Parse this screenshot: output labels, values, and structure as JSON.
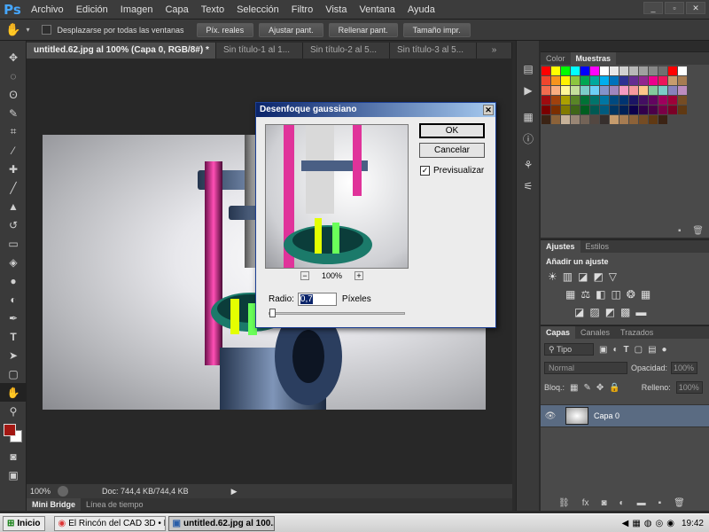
{
  "app": {
    "logo": "Ps"
  },
  "menu": [
    "Archivo",
    "Edición",
    "Imagen",
    "Capa",
    "Texto",
    "Selección",
    "Filtro",
    "Vista",
    "Ventana",
    "Ayuda"
  ],
  "options_bar": {
    "scroll_all_label": "Desplazarse por todas las ventanas",
    "buttons": [
      "Píx. reales",
      "Ajustar pant.",
      "Rellenar pant.",
      "Tamaño impr."
    ]
  },
  "doc_tabs": [
    {
      "label": "untitled.62.jpg al 100% (Capa 0, RGB/8#) *",
      "active": true
    },
    {
      "label": "Sin título-1 al 1...",
      "active": false
    },
    {
      "label": "Sin título-2 al 5...",
      "active": false
    },
    {
      "label": "Sin título-3 al 5...",
      "active": false
    }
  ],
  "status": {
    "zoom": "100%",
    "doc": "Doc: 744,4 KB/744,4 KB"
  },
  "bottom_tabs": [
    "Mini Bridge",
    "Línea de tiempo"
  ],
  "panels": {
    "color_tabs": [
      "Color",
      "Muestras"
    ],
    "adjust_tabs": [
      "Ajustes",
      "Estilos"
    ],
    "adjust_title": "Añadir un ajuste",
    "layers_tabs": [
      "Capas",
      "Canales",
      "Trazados"
    ],
    "kind_filter": "Tipo",
    "blend_mode": "Normal",
    "opacity_label": "Opacidad:",
    "opacity_value": "100%",
    "lock_label": "Bloq.:",
    "fill_label": "Relleno:",
    "fill_value": "100%",
    "layer_name": "Capa 0"
  },
  "dialog": {
    "title": "Desenfoque gaussiano",
    "ok": "OK",
    "cancel": "Cancelar",
    "preview_label": "Previsualizar",
    "preview_checked": true,
    "zoom": "100%",
    "radius_label": "Radio:",
    "radius_value": "0,7",
    "radius_unit": "Píxeles"
  },
  "taskbar": {
    "start": "Inicio",
    "items": [
      "El Rincón del CAD 3D • E...",
      "untitled.62.jpg al 100..."
    ],
    "clock": "19:42"
  },
  "swatches": [
    "#ff0000",
    "#ffff00",
    "#00ff00",
    "#00ffff",
    "#0000ff",
    "#ff00ff",
    "#ffffff",
    "#e8e8e8",
    "#d0d0d0",
    "#b8b8b8",
    "#a0a0a0",
    "#888888",
    "#707070",
    "#ff0000",
    "#ffffff",
    "#f0452d",
    "#f7941d",
    "#fff200",
    "#8dc63f",
    "#00a651",
    "#00a99d",
    "#00aeef",
    "#0072bc",
    "#2e3192",
    "#662d91",
    "#92278f",
    "#ec008c",
    "#ed145b",
    "#c69c6d",
    "#a67c52",
    "#f26c4f",
    "#f9ad81",
    "#fff799",
    "#c4df9b",
    "#7bcdc8",
    "#6dcff6",
    "#8393ca",
    "#a186be",
    "#f49ac1",
    "#f6989d",
    "#fdc689",
    "#82ca9c",
    "#7accc8",
    "#8781bd",
    "#bd8cbf",
    "#9e0b0f",
    "#a0410d",
    "#aba000",
    "#598527",
    "#007236",
    "#00746b",
    "#0076a3",
    "#004a80",
    "#003471",
    "#1b1464",
    "#440e62",
    "#630460",
    "#9e005d",
    "#9e0039",
    "#754c24",
    "#790000",
    "#7b2e00",
    "#827b00",
    "#406618",
    "#005e20",
    "#005952",
    "#005b7f",
    "#003663",
    "#002157",
    "#0d004c",
    "#32004b",
    "#4b0049",
    "#7b0046",
    "#7a0026",
    "#603913",
    "#3b2314",
    "#8c6239",
    "#c7b299",
    "#998675",
    "#736357",
    "#534741",
    "#362f2d",
    "#c69c6d",
    "#a67c52",
    "#8c6239",
    "#754c24",
    "#603913",
    "#3b2314"
  ]
}
